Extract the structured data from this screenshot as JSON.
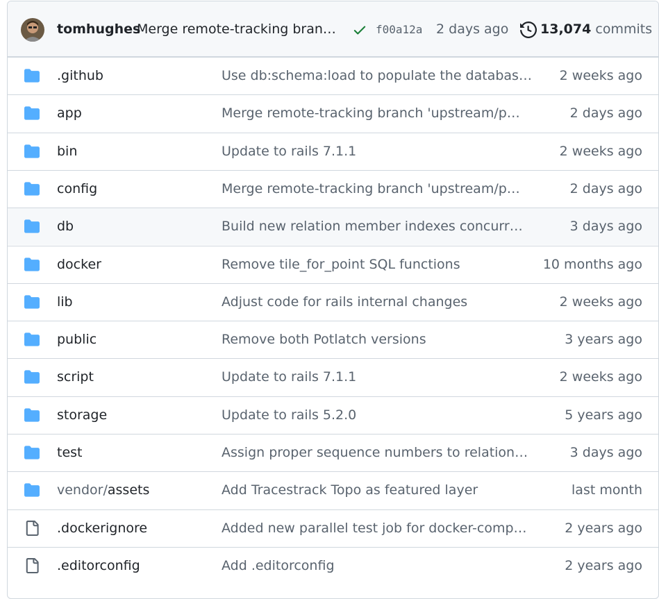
{
  "commit": {
    "author": "tomhughes",
    "message": "Merge remote-tracking bran…",
    "sha": "f00a12a",
    "date": "2 days ago",
    "commit_count": "13,074",
    "commit_label": "commits",
    "status_icon": "check-icon",
    "history_icon": "history-icon"
  },
  "files": [
    {
      "type": "folder",
      "name": ".github",
      "message": "Use db:schema:load to populate the databas…",
      "date": "2 weeks ago"
    },
    {
      "type": "folder",
      "name": "app",
      "message": "Merge remote-tracking branch 'upstream/p…",
      "date": "2 days ago"
    },
    {
      "type": "folder",
      "name": "bin",
      "message": "Update to rails 7.1.1",
      "date": "2 weeks ago"
    },
    {
      "type": "folder",
      "name": "config",
      "message": "Merge remote-tracking branch 'upstream/p…",
      "date": "2 days ago"
    },
    {
      "type": "folder",
      "name": "db",
      "message": "Build new relation member indexes concurr…",
      "date": "3 days ago"
    },
    {
      "type": "folder",
      "name": "docker",
      "message": "Remove tile_for_point SQL functions",
      "date": "10 months ago"
    },
    {
      "type": "folder",
      "name": "lib",
      "message": "Adjust code for rails internal changes",
      "date": "2 weeks ago"
    },
    {
      "type": "folder",
      "name": "public",
      "message": "Remove both Potlatch versions",
      "date": "3 years ago"
    },
    {
      "type": "folder",
      "name": "script",
      "message": "Update to rails 7.1.1",
      "date": "2 weeks ago"
    },
    {
      "type": "folder",
      "name": "storage",
      "message": "Update to rails 5.2.0",
      "date": "5 years ago"
    },
    {
      "type": "folder",
      "name": "test",
      "message": "Assign proper sequence numbers to relation…",
      "date": "3 days ago"
    },
    {
      "type": "folder",
      "name_prefix": "vendor/",
      "name": "assets",
      "message": "Add Tracestrack Topo as featured layer",
      "date": "last month"
    },
    {
      "type": "file",
      "name": ".dockerignore",
      "message": "Added new parallel test job for docker-comp…",
      "date": "2 years ago"
    },
    {
      "type": "file",
      "name": ".editorconfig",
      "message": "Add .editorconfig",
      "date": "2 years ago"
    }
  ],
  "colors": {
    "folder": "#54aeff",
    "success": "#1a7f37",
    "muted": "#59636e",
    "border": "#d0d7de",
    "header_bg": "#f6f8fa"
  }
}
